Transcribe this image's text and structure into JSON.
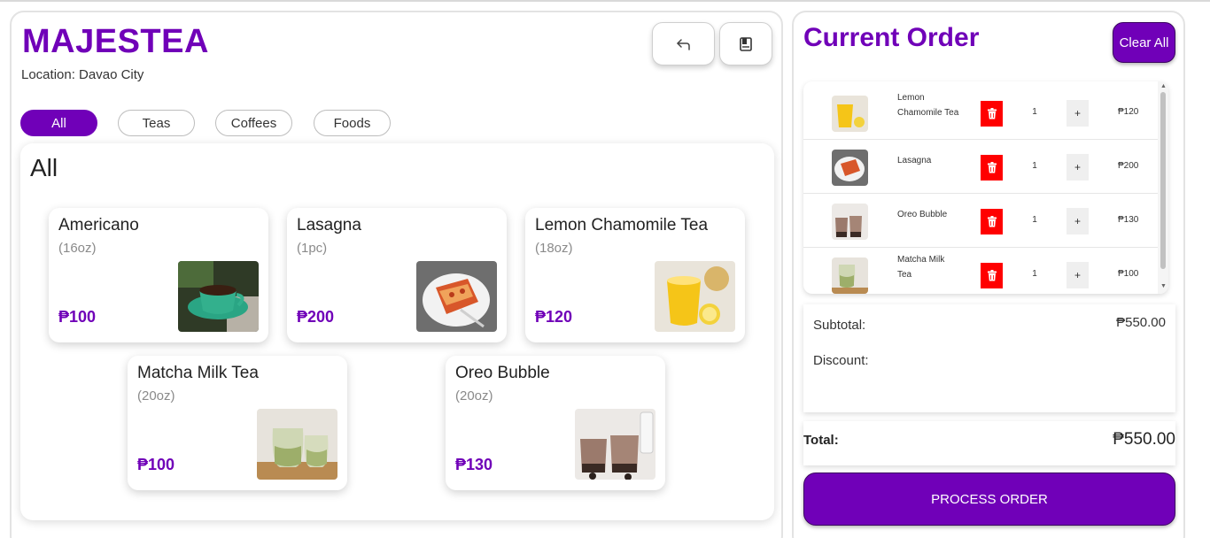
{
  "brand": {
    "name": "MAJESTEA",
    "location": "Location: Davao City"
  },
  "toolbar": {
    "back_icon": "return-arrow-icon",
    "book_icon": "notebook-icon"
  },
  "categories": [
    "All",
    "Teas",
    "Coffees",
    "Foods"
  ],
  "active_category": "All",
  "products_section": {
    "title": "All"
  },
  "products": [
    {
      "name": "Americano",
      "size": "(16oz)",
      "price": "₱100",
      "image": "coffee-cup-image"
    },
    {
      "name": "Lasagna",
      "size": "(1pc)",
      "price": "₱200",
      "image": "lasagna-image"
    },
    {
      "name": "Lemon Chamomile Tea",
      "size": "(18oz)",
      "price": "₱120",
      "image": "lemon-tea-image"
    },
    {
      "name": "Matcha Milk Tea",
      "size": "(20oz)",
      "price": "₱100",
      "image": "matcha-image"
    },
    {
      "name": "Oreo Bubble",
      "size": "(20oz)",
      "price": "₱130",
      "image": "oreo-bubble-image"
    }
  ],
  "order": {
    "title": "Current Order",
    "clear_label": "Clear All",
    "items": [
      {
        "name": "Lemon Chamomile Tea",
        "qty": "1",
        "plus": "+",
        "price": "₱120"
      },
      {
        "name": "Lasagna",
        "qty": "1",
        "plus": "+",
        "price": "₱200"
      },
      {
        "name": "Oreo Bubble",
        "qty": "1",
        "plus": "+",
        "price": "₱130"
      },
      {
        "name": "Matcha Milk Tea",
        "qty": "1",
        "plus": "+",
        "price": "₱100"
      }
    ],
    "subtotal_label": "Subtotal:",
    "subtotal_value": "₱550.00",
    "discount_label": "Discount:",
    "total_label": "Total:",
    "total_value": "₱550.00",
    "process_label": "PROCESS ORDER"
  },
  "colors": {
    "accent": "#7000b8",
    "delete": "#ff0000"
  }
}
